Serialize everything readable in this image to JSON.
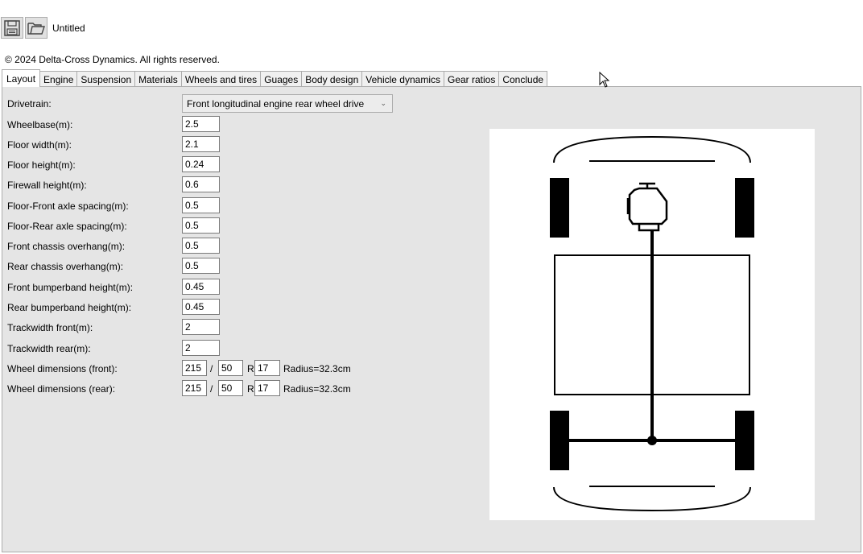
{
  "toolbar": {
    "save_icon": "floppy-disk-icon",
    "open_icon": "folder-open-icon",
    "doc_title": "Untitled"
  },
  "copyright": "© 2024 Delta-Cross Dynamics. All rights reserved.",
  "tabs": [
    {
      "label": "Layout",
      "active": true
    },
    {
      "label": "Engine"
    },
    {
      "label": "Suspension"
    },
    {
      "label": "Materials"
    },
    {
      "label": "Wheels and tires"
    },
    {
      "label": "Guages"
    },
    {
      "label": "Body design"
    },
    {
      "label": "Vehicle dynamics"
    },
    {
      "label": "Gear ratios"
    },
    {
      "label": "Conclude"
    }
  ],
  "form": {
    "drivetrain_label": "Drivetrain:",
    "drivetrain_value": "Front longitudinal engine rear wheel drive",
    "fields": [
      {
        "label": "Wheelbase(m):",
        "value": "2.5"
      },
      {
        "label": "Floor width(m):",
        "value": "2.1"
      },
      {
        "label": "Floor height(m):",
        "value": "0.24"
      },
      {
        "label": "Firewall height(m):",
        "value": "0.6"
      },
      {
        "label": "Floor-Front axle spacing(m):",
        "value": "0.5"
      },
      {
        "label": "Floor-Rear axle spacing(m):",
        "value": "0.5"
      },
      {
        "label": "Front chassis overhang(m):",
        "value": "0.5"
      },
      {
        "label": "Rear chassis overhang(m):",
        "value": "0.5"
      },
      {
        "label": "Front bumperband height(m):",
        "value": "0.45"
      },
      {
        "label": "Rear bumperband height(m):",
        "value": "0.45"
      },
      {
        "label": "Trackwidth front(m):",
        "value": "2"
      },
      {
        "label": "Trackwidth rear(m):",
        "value": "2"
      }
    ],
    "wheel_front": {
      "label": "Wheel dimensions (front):",
      "width": "215",
      "slash": "/",
      "aspect": "50",
      "r": "R",
      "rim": "17",
      "radius": "Radius=32.3cm"
    },
    "wheel_rear": {
      "label": "Wheel dimensions (rear):",
      "width": "215",
      "slash": "/",
      "aspect": "50",
      "r": "R",
      "rim": "17",
      "radius": "Radius=32.3cm"
    }
  }
}
